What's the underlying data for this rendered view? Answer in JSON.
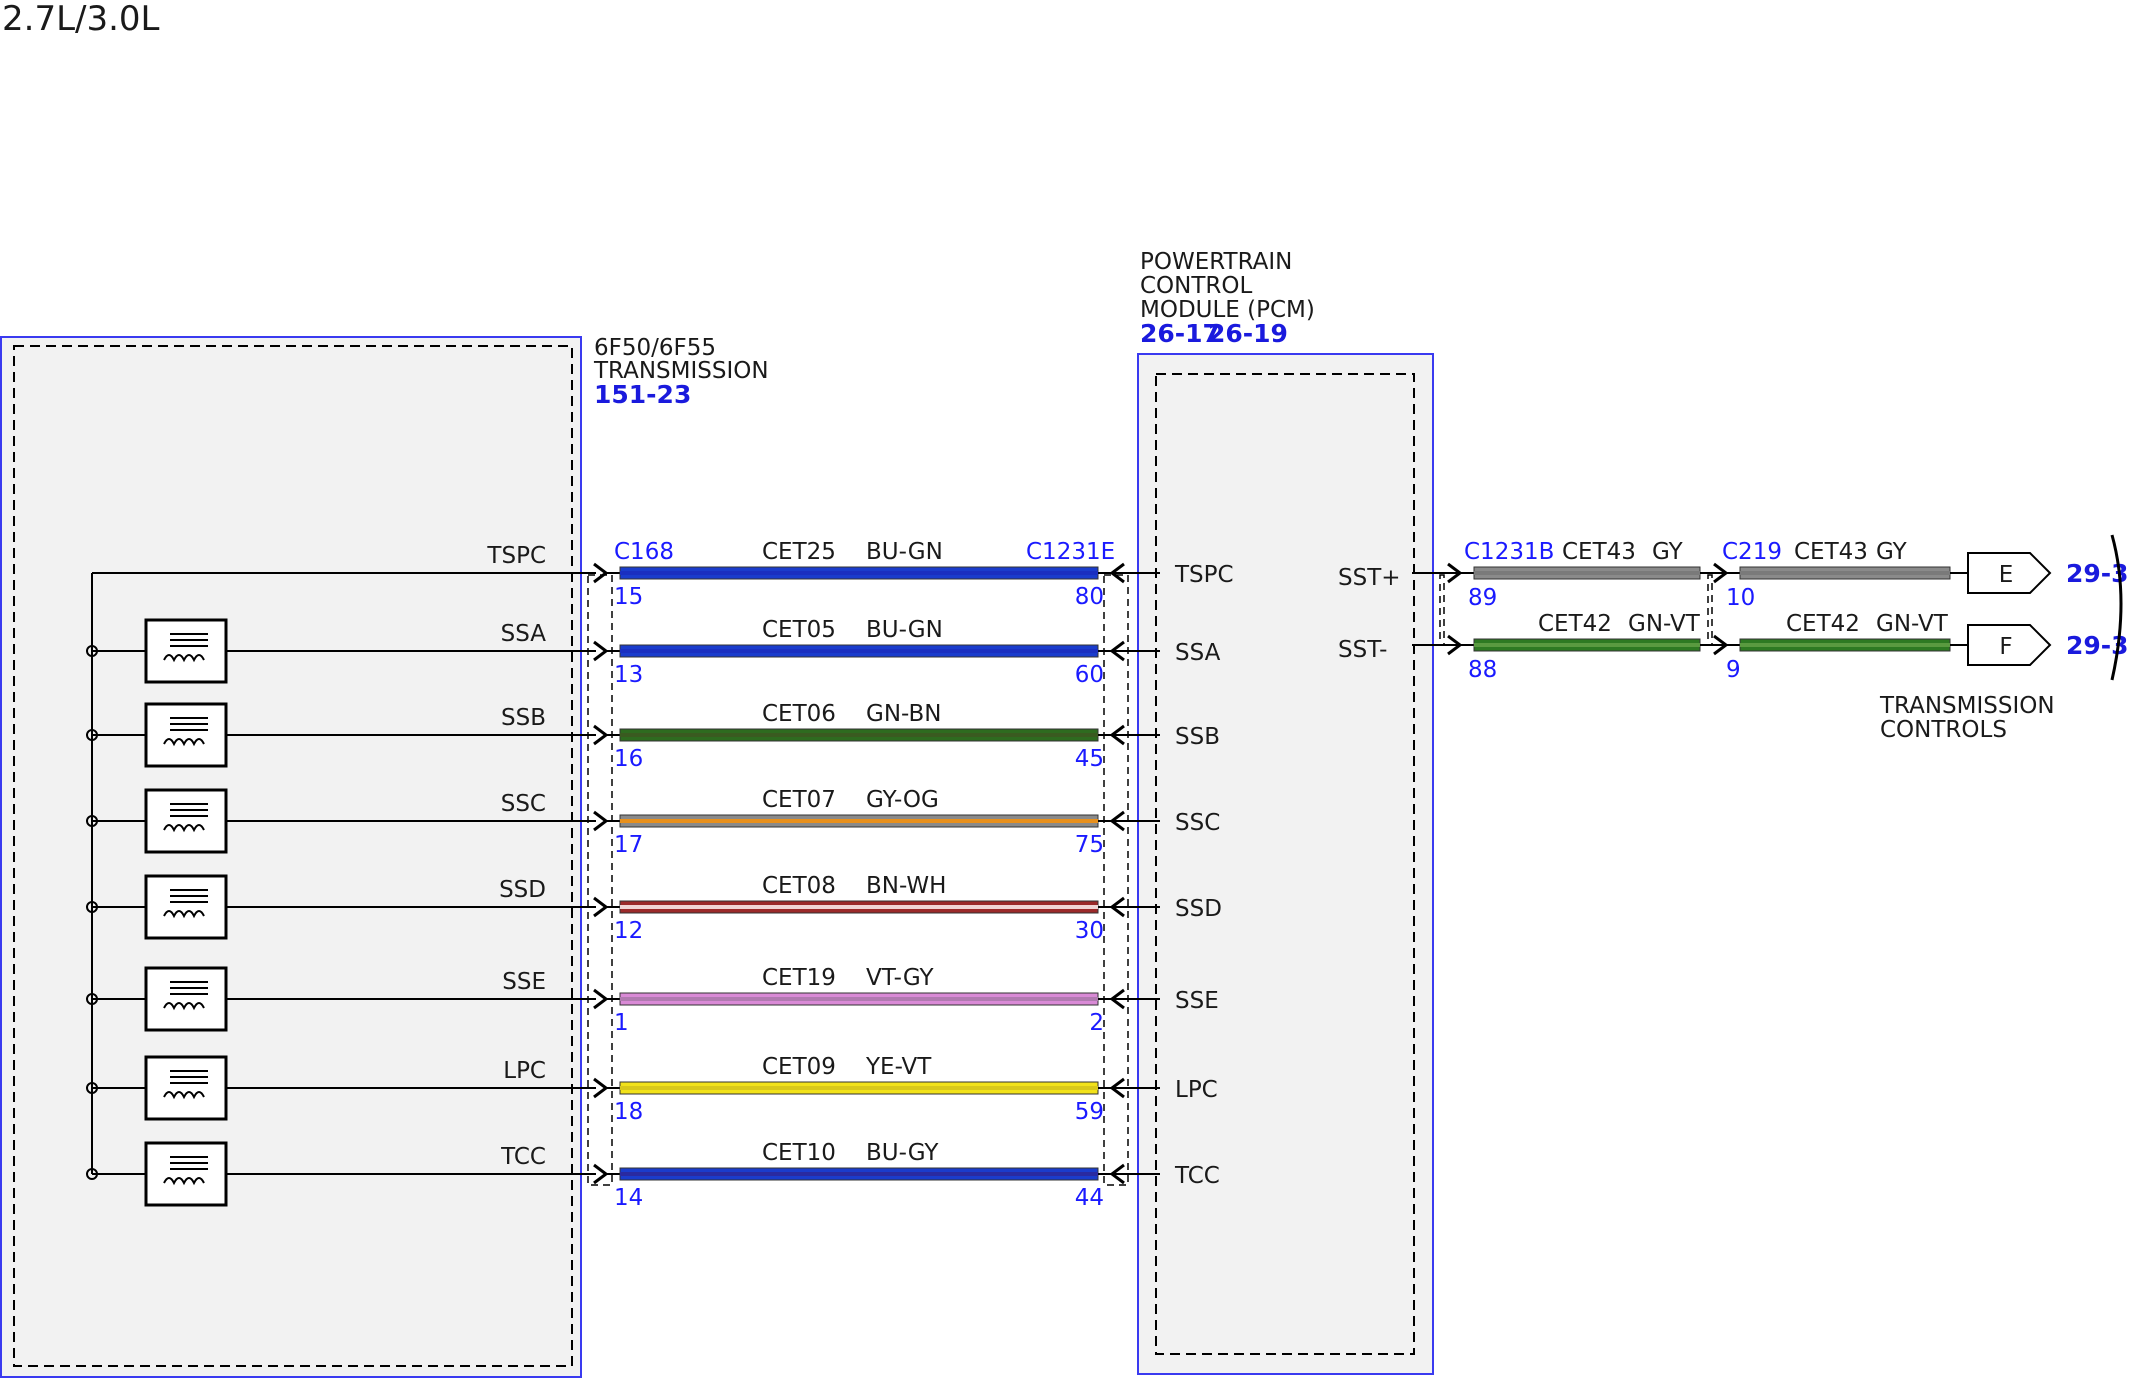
{
  "title": "2.7L/3.0L",
  "transmission": {
    "name_line1": "6F50/6F55",
    "name_line2": "TRANSMISSION",
    "ref": "151-23",
    "connector": "C168"
  },
  "pcm": {
    "name_line1": "POWERTRAIN",
    "name_line2": "CONTROL",
    "name_line3": "MODULE (PCM)",
    "ref1": "26-17",
    "ref2": "26-19",
    "connector": "C1231E"
  },
  "circuits": [
    {
      "signal": "TSPC",
      "circuit": "CET25",
      "color_code": "BU-GN",
      "trans_pin": "15",
      "pcm_pin": "80",
      "colors": [
        "#1a3ccc",
        "#1a2fc0"
      ],
      "solenoid": false
    },
    {
      "signal": "SSA",
      "circuit": "CET05",
      "color_code": "BU-GN",
      "trans_pin": "13",
      "pcm_pin": "60",
      "colors": [
        "#1a3ccc",
        "#1a2fc0"
      ],
      "solenoid": true
    },
    {
      "signal": "SSB",
      "circuit": "CET06",
      "color_code": "GN-BN",
      "trans_pin": "16",
      "pcm_pin": "45",
      "colors": [
        "#2e6b1f",
        "#3a5a20"
      ],
      "solenoid": true
    },
    {
      "signal": "SSC",
      "circuit": "CET07",
      "color_code": "GY-OG",
      "trans_pin": "17",
      "pcm_pin": "75",
      "colors": [
        "#8a8a8a",
        "#e8901c"
      ],
      "solenoid": true
    },
    {
      "signal": "SSD",
      "circuit": "CET08",
      "color_code": "BN-WH",
      "trans_pin": "12",
      "pcm_pin": "30",
      "colors": [
        "#9b2a2a",
        "#f0d6d6"
      ],
      "solenoid": true
    },
    {
      "signal": "SSE",
      "circuit": "CET19",
      "color_code": "VT-GY",
      "trans_pin": "1",
      "pcm_pin": "2",
      "colors": [
        "#d98ad6",
        "#b07ab0"
      ],
      "solenoid": true
    },
    {
      "signal": "LPC",
      "circuit": "CET09",
      "color_code": "YE-VT",
      "trans_pin": "18",
      "pcm_pin": "59",
      "colors": [
        "#f2e21a",
        "#d8c81a"
      ],
      "solenoid": true
    },
    {
      "signal": "TCC",
      "circuit": "CET10",
      "color_code": "BU-GY",
      "trans_pin": "14",
      "pcm_pin": "44",
      "colors": [
        "#1a3ccc",
        "#2a2aa0"
      ],
      "solenoid": true
    }
  ],
  "right": {
    "connector1": "C1231B",
    "connector2": "C219",
    "label": "TRANSMISSION\nCONTROLS",
    "label_line1": "TRANSMISSION",
    "label_line2": "CONTROLS",
    "rows": [
      {
        "signal": "SST+",
        "circuit": "CET43",
        "color_code": "GY",
        "pin1": "89",
        "pin2": "10",
        "tag": "E",
        "ref": "29-3",
        "colors": [
          "#8a8a8a",
          "#7a7a7a"
        ]
      },
      {
        "signal": "SST-",
        "circuit": "CET42",
        "color_code": "GN-VT",
        "pin1": "88",
        "pin2": "9",
        "tag": "F",
        "ref": "29-3",
        "colors": [
          "#2e7a22",
          "#5a9a40"
        ]
      }
    ]
  }
}
